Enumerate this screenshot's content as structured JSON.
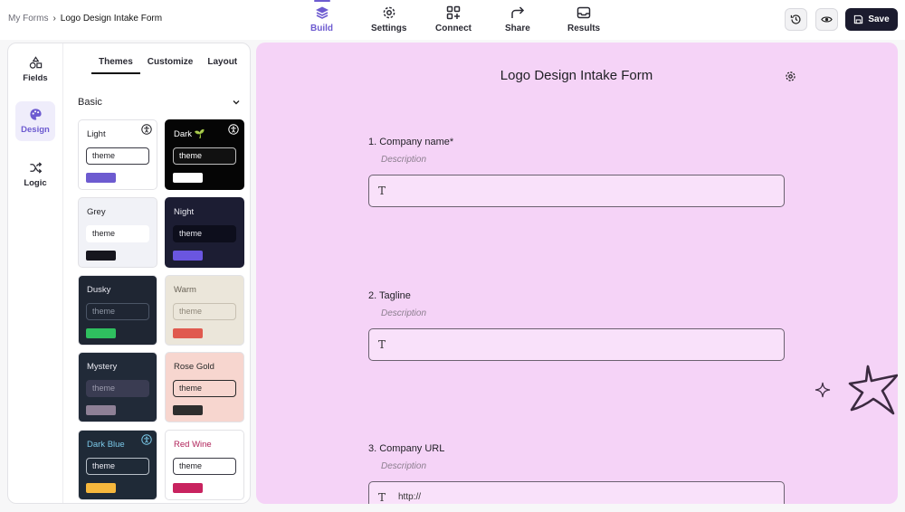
{
  "breadcrumb": {
    "root": "My Forms",
    "separator": "›",
    "current": "Logo Design Intake Form"
  },
  "nav": {
    "build": "Build",
    "settings": "Settings",
    "connect": "Connect",
    "share": "Share",
    "results": "Results"
  },
  "actions": {
    "save": "Save"
  },
  "rail": {
    "fields": "Fields",
    "design": "Design",
    "logic": "Logic"
  },
  "subtabs": {
    "themes": "Themes",
    "customize": "Customize",
    "layout": "Layout"
  },
  "section": {
    "title": "Basic"
  },
  "themes": [
    {
      "name": "Light",
      "placeholder": "theme",
      "bg": "#ffffff",
      "text": "#1f1f24",
      "box_bg": "#ffffff",
      "box_border": "#3a3a44",
      "box_text": "#1f1f24",
      "swatch": "#6d5bd0",
      "accessible": true
    },
    {
      "name": "Dark 🌱",
      "placeholder": "theme",
      "bg": "#050505",
      "text": "#ffffff",
      "box_bg": "#111111",
      "box_border": "#bdbdbd",
      "box_text": "#ffffff",
      "swatch": "#ffffff",
      "accessible": true
    },
    {
      "name": "Grey",
      "placeholder": "theme",
      "bg": "#f1f2f7",
      "text": "#1f1f24",
      "box_bg": "#ffffff",
      "box_border": "#ffffff",
      "box_text": "#1f1f24",
      "swatch": "#16161e",
      "accessible": false
    },
    {
      "name": "Night",
      "placeholder": "theme",
      "bg": "#1c1d33",
      "text": "#e8e8f0",
      "box_bg": "#0d0e1c",
      "box_border": "#0d0e1c",
      "box_text": "#e8e8f0",
      "swatch": "#6a56e0",
      "accessible": false
    },
    {
      "name": "Dusky",
      "placeholder": "theme",
      "bg": "#1f2633",
      "text": "#e8e8f0",
      "box_bg": "#1f2633",
      "box_border": "#4b5566",
      "box_text": "#8d95a3",
      "swatch": "#2fbf5f",
      "accessible": false
    },
    {
      "name": "Warm",
      "placeholder": "theme",
      "bg": "#ebe6da",
      "text": "#6b6458",
      "box_bg": "#ebe6da",
      "box_border": "#c8c1b2",
      "box_text": "#8d8678",
      "swatch": "#e05a4f",
      "accessible": false
    },
    {
      "name": "Mystery",
      "placeholder": "theme",
      "bg": "#212a38",
      "text": "#e8e8f0",
      "box_bg": "#3a3c52",
      "box_border": "#3a3c52",
      "box_text": "#9a9aac",
      "swatch": "#8e8096",
      "accessible": false
    },
    {
      "name": "Rose Gold",
      "placeholder": "theme",
      "bg": "#f7d6cf",
      "text": "#2a2a2a",
      "box_bg": "#f7d6cf",
      "box_border": "#2a2a2a",
      "box_text": "#2a2a2a",
      "swatch": "#2e2e2e",
      "accessible": false
    },
    {
      "name": "Dark Blue",
      "placeholder": "theme",
      "bg": "#1f2a37",
      "text": "#7ac8e8",
      "box_bg": "#1f2a37",
      "box_border": "#b8c0c8",
      "box_text": "#e8e8f0",
      "swatch": "#f6b73c",
      "accessible": true
    },
    {
      "name": "Red Wine",
      "placeholder": "theme",
      "bg": "#ffffff",
      "text": "#b0235a",
      "box_bg": "#ffffff",
      "box_border": "#3a3a44",
      "box_text": "#1f1f24",
      "swatch": "#c8235f",
      "accessible": false
    }
  ],
  "form": {
    "title": "Logo Design Intake Form",
    "questions": [
      {
        "label": "1.  Company name*",
        "description": "Description",
        "placeholder": ""
      },
      {
        "label": "2.  Tagline",
        "description": "Description",
        "placeholder": ""
      },
      {
        "label": "3.  Company URL",
        "description": "Description",
        "placeholder": "http://"
      }
    ]
  },
  "colors": {
    "accent": "#6d5bd0",
    "canvas_bg": "#f5d3f7",
    "save_bg": "#1b1b2e"
  }
}
